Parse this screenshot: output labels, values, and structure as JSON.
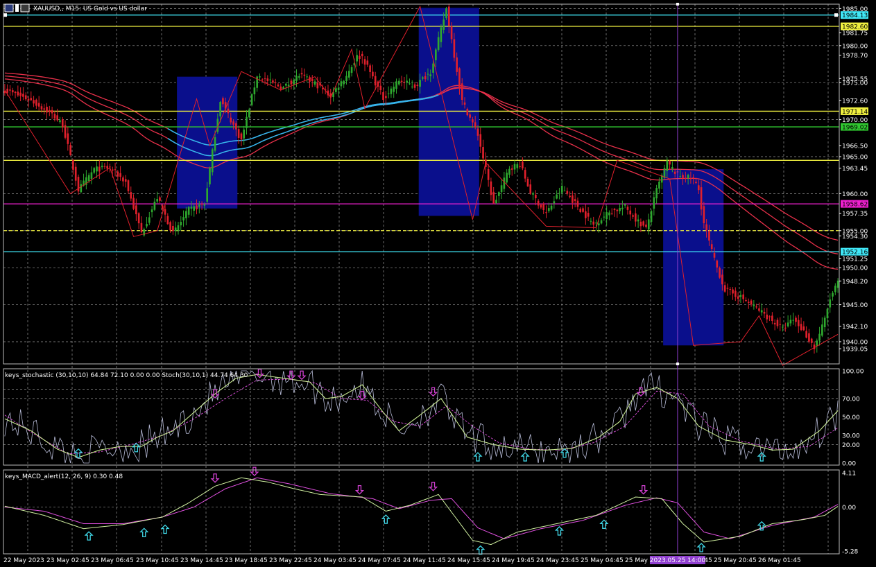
{
  "colors": {
    "bg": "#000000",
    "grid": "#9a9a9a",
    "axis_text": "#ffffff",
    "bull": "#2ea82e",
    "bear": "#e0202c",
    "ma_red": "#e8304a",
    "ma_blue": "#2fb8f0",
    "zigzag": "#e0202c",
    "zone": "#0a0f8c",
    "stoch_main": "#c8e890",
    "stoch_signal": "#e050e0",
    "stoch_raw": "#b8bcd8",
    "macd_main": "#d0f0a0",
    "macd_signal": "#e050e0",
    "arrow_up": "#40d8e8",
    "arrow_down": "#d040d0",
    "cursor": "#9040d0"
  },
  "header": {
    "title": "XAUUSD,, M15: US Gold vs US dollar"
  },
  "chart_data": [
    {
      "type": "candlestick",
      "name": "price",
      "ylim": [
        1937,
        1985.6
      ],
      "ticks": [
        "1985.00",
        "1981.75",
        "1980.00",
        "1978.70",
        "1975.55",
        "1975.00",
        "1972.60",
        "1970.00",
        "1966.50",
        "1965.00",
        "1963.45",
        "1960.00",
        "1957.35",
        "1955.00",
        "1954.30",
        "1951.25",
        "1950.00",
        "1948.20",
        "1945.00",
        "1942.10",
        "1940.00",
        "1939.05"
      ],
      "x_labels": [
        "22 May 2023",
        "23 May 02:45",
        "23 May 06:45",
        "23 May 10:45",
        "23 May 14:45",
        "23 May 18:45",
        "23 May 22:45",
        "24 May 03:45",
        "24 May 07:45",
        "24 May 11:45",
        "24 May 15:45",
        "24 May 19:45",
        "24 May 23:45",
        "25 May 04:45",
        "25 May 08",
        "25 May 16:45",
        "25 May 20:45",
        "26 May 01:45"
      ],
      "cursor_time": "2023.05.25 14:00",
      "path": [
        [
          0,
          1974
        ],
        [
          10,
          1972.6
        ],
        [
          18,
          1970.7
        ],
        [
          22,
          1969.3
        ],
        [
          28,
          1960.5
        ],
        [
          34,
          1963.3
        ],
        [
          40,
          1963.5
        ],
        [
          46,
          1961.6
        ],
        [
          52,
          1954.7
        ],
        [
          58,
          1959.5
        ],
        [
          64,
          1954.6
        ],
        [
          70,
          1957.8
        ],
        [
          76,
          1958.6
        ],
        [
          82,
          1972.7
        ],
        [
          90,
          1967.2
        ],
        [
          96,
          1976
        ],
        [
          100,
          1975.2
        ],
        [
          106,
          1974.3
        ],
        [
          112,
          1976
        ],
        [
          118,
          1974.9
        ],
        [
          124,
          1973.2
        ],
        [
          130,
          1976
        ],
        [
          134,
          1978.5
        ],
        [
          136,
          1978.5
        ],
        [
          144,
          1972.9
        ],
        [
          150,
          1975.3
        ],
        [
          156,
          1974.5
        ],
        [
          162,
          1976.5
        ],
        [
          168,
          1985
        ],
        [
          174,
          1972.5
        ],
        [
          180,
          1968
        ],
        [
          186,
          1958.5
        ],
        [
          192,
          1963.5
        ],
        [
          196,
          1964
        ],
        [
          200,
          1960.2
        ],
        [
          206,
          1957.3
        ],
        [
          212,
          1960.8
        ],
        [
          218,
          1958.3
        ],
        [
          224,
          1955.8
        ],
        [
          230,
          1957.5
        ],
        [
          236,
          1958.2
        ],
        [
          240,
          1956.6
        ],
        [
          244,
          1955.2
        ],
        [
          248,
          1960.5
        ],
        [
          252,
          1964.2
        ],
        [
          256,
          1962.5
        ],
        [
          262,
          1962
        ],
        [
          264,
          1960.5
        ],
        [
          266,
          1956
        ],
        [
          270,
          1951
        ],
        [
          274,
          1947
        ],
        [
          280,
          1946
        ],
        [
          288,
          1944
        ],
        [
          296,
          1941.7
        ],
        [
          300,
          1943
        ],
        [
          304,
          1941.4
        ],
        [
          308,
          1939.2
        ],
        [
          312,
          1943
        ],
        [
          314,
          1945.8
        ],
        [
          317,
          1948
        ]
      ],
      "levels": [
        {
          "value": 1984.13,
          "color": "#40e8f8",
          "label": "1984.13",
          "style": "solid"
        },
        {
          "value": 1982.6,
          "color": "#f0f040",
          "label": "1982.60",
          "style": "solid"
        },
        {
          "value": 1971.14,
          "color": "#f0f040",
          "label": "1971.14",
          "style": "solid"
        },
        {
          "value": 1969.02,
          "color": "#30c830",
          "label": "1969.02",
          "style": "solid"
        },
        {
          "value": 1964.5,
          "color": "#f0f040",
          "label": "",
          "style": "solid"
        },
        {
          "value": 1958.62,
          "color": "#f020d0",
          "label": "1958.62",
          "style": "solid"
        },
        {
          "value": 1955.0,
          "color": "#f0f040",
          "label": "",
          "style": "dashed"
        },
        {
          "value": 1952.16,
          "color": "#40e8f8",
          "label": "1952.16",
          "style": "solid"
        }
      ],
      "zones": [
        {
          "from": 66,
          "to": 89,
          "top": 1975.8,
          "bottom": 1958
        },
        {
          "from": 158,
          "to": 181,
          "top": 1985.1,
          "bottom": 1957
        },
        {
          "from": 251,
          "to": 274,
          "top": 1963.3,
          "bottom": 1939.5
        }
      ]
    },
    {
      "type": "line",
      "name": "keys_stochastic",
      "label": "keys_stochastic (30,10,10) 64.84 72.10 0.00 0.00 Stoch(30,10,1) 44.74 64.30",
      "ylim": [
        0,
        100
      ],
      "ticks": [
        "100.00",
        "70.00",
        "50.00",
        "30.00",
        "20.00",
        "0.00"
      ],
      "levels": [
        80,
        70,
        20
      ],
      "main": [
        [
          0,
          48
        ],
        [
          10,
          35
        ],
        [
          20,
          15
        ],
        [
          28,
          6
        ],
        [
          36,
          14
        ],
        [
          44,
          18
        ],
        [
          52,
          18
        ],
        [
          58,
          28
        ],
        [
          64,
          35
        ],
        [
          72,
          55
        ],
        [
          80,
          75
        ],
        [
          88,
          92
        ],
        [
          96,
          96
        ],
        [
          106,
          92
        ],
        [
          116,
          88
        ],
        [
          122,
          70
        ],
        [
          128,
          72
        ],
        [
          136,
          85
        ],
        [
          144,
          55
        ],
        [
          150,
          35
        ],
        [
          158,
          52
        ],
        [
          166,
          70
        ],
        [
          176,
          28
        ],
        [
          186,
          20
        ],
        [
          196,
          15
        ],
        [
          206,
          14
        ],
        [
          216,
          16
        ],
        [
          226,
          28
        ],
        [
          234,
          45
        ],
        [
          240,
          75
        ],
        [
          248,
          82
        ],
        [
          256,
          70
        ],
        [
          264,
          40
        ],
        [
          274,
          25
        ],
        [
          284,
          20
        ],
        [
          292,
          14
        ],
        [
          300,
          15
        ],
        [
          310,
          35
        ],
        [
          318,
          60
        ]
      ],
      "signal": [
        [
          0,
          52
        ],
        [
          12,
          30
        ],
        [
          24,
          10
        ],
        [
          36,
          12
        ],
        [
          48,
          20
        ],
        [
          60,
          30
        ],
        [
          72,
          48
        ],
        [
          84,
          70
        ],
        [
          96,
          90
        ],
        [
          108,
          91
        ],
        [
          118,
          87
        ],
        [
          128,
          70
        ],
        [
          138,
          68
        ],
        [
          148,
          45
        ],
        [
          158,
          40
        ],
        [
          168,
          62
        ],
        [
          178,
          40
        ],
        [
          188,
          22
        ],
        [
          200,
          15
        ],
        [
          212,
          14
        ],
        [
          224,
          22
        ],
        [
          236,
          40
        ],
        [
          248,
          78
        ],
        [
          258,
          75
        ],
        [
          268,
          40
        ],
        [
          280,
          24
        ],
        [
          294,
          15
        ],
        [
          306,
          18
        ],
        [
          318,
          40
        ]
      ],
      "raw_seed": 42,
      "arrows": [
        [
          28,
          "up",
          16
        ],
        [
          50,
          "up",
          22
        ],
        [
          80,
          "down",
          70
        ],
        [
          97,
          "down",
          92
        ],
        [
          109,
          "down",
          90
        ],
        [
          113,
          "down",
          90
        ],
        [
          136,
          "down",
          68
        ],
        [
          163,
          "down",
          72
        ],
        [
          180,
          "up",
          12
        ],
        [
          198,
          "up",
          12
        ],
        [
          213,
          "up",
          16
        ],
        [
          242,
          "down",
          72
        ],
        [
          288,
          "up",
          12
        ]
      ]
    },
    {
      "type": "line",
      "name": "keys_MACD_alert",
      "label": "keys_MACD_alert(12, 26, 9) 0.30 0.48",
      "ylim": [
        -5.28,
        4.11
      ],
      "ticks": [
        "4.11",
        "0.00",
        "-5.28"
      ],
      "main": [
        [
          0,
          0.1
        ],
        [
          15,
          -1.0
        ],
        [
          30,
          -2.6
        ],
        [
          45,
          -2.1
        ],
        [
          60,
          -1.2
        ],
        [
          70,
          0.5
        ],
        [
          80,
          2.5
        ],
        [
          90,
          3.5
        ],
        [
          100,
          3.0
        ],
        [
          110,
          2.2
        ],
        [
          120,
          1.5
        ],
        [
          136,
          1.2
        ],
        [
          145,
          -0.5
        ],
        [
          154,
          0.2
        ],
        [
          165,
          1.5
        ],
        [
          178,
          -4.0
        ],
        [
          185,
          -4.5
        ],
        [
          195,
          -3.0
        ],
        [
          210,
          -2.0
        ],
        [
          225,
          -1.0
        ],
        [
          240,
          1.2
        ],
        [
          250,
          1.0
        ],
        [
          258,
          -2.0
        ],
        [
          266,
          -4.2
        ],
        [
          280,
          -3.5
        ],
        [
          292,
          -2.0
        ],
        [
          304,
          -1.5
        ],
        [
          312,
          -1.0
        ],
        [
          318,
          0.3
        ]
      ],
      "signal": [
        [
          0,
          0.0
        ],
        [
          15,
          -0.5
        ],
        [
          30,
          -2.0
        ],
        [
          45,
          -2.0
        ],
        [
          60,
          -1.2
        ],
        [
          72,
          0.0
        ],
        [
          84,
          2.2
        ],
        [
          96,
          3.5
        ],
        [
          108,
          2.8
        ],
        [
          124,
          1.6
        ],
        [
          140,
          1.0
        ],
        [
          150,
          -0.2
        ],
        [
          162,
          0.8
        ],
        [
          170,
          1.0
        ],
        [
          180,
          -2.5
        ],
        [
          190,
          -3.8
        ],
        [
          204,
          -2.6
        ],
        [
          220,
          -1.6
        ],
        [
          236,
          0.2
        ],
        [
          248,
          1.1
        ],
        [
          256,
          0.5
        ],
        [
          266,
          -3.0
        ],
        [
          276,
          -3.8
        ],
        [
          292,
          -2.2
        ],
        [
          308,
          -1.2
        ],
        [
          318,
          0.48
        ]
      ],
      "arrows": [
        [
          32,
          "up",
          -2.8
        ],
        [
          53,
          "up",
          -2.4
        ],
        [
          61,
          "up",
          -2.0
        ],
        [
          80,
          "down",
          2.8
        ],
        [
          95,
          "down",
          3.6
        ],
        [
          135,
          "down",
          1.4
        ],
        [
          145,
          "up",
          -0.8
        ],
        [
          163,
          "down",
          1.8
        ],
        [
          181,
          "up",
          -4.5
        ],
        [
          211,
          "up",
          -2.2
        ],
        [
          228,
          "up",
          -1.4
        ],
        [
          243,
          "down",
          1.4
        ],
        [
          265,
          "up",
          -4.2
        ],
        [
          288,
          "up",
          -1.6
        ]
      ]
    }
  ]
}
